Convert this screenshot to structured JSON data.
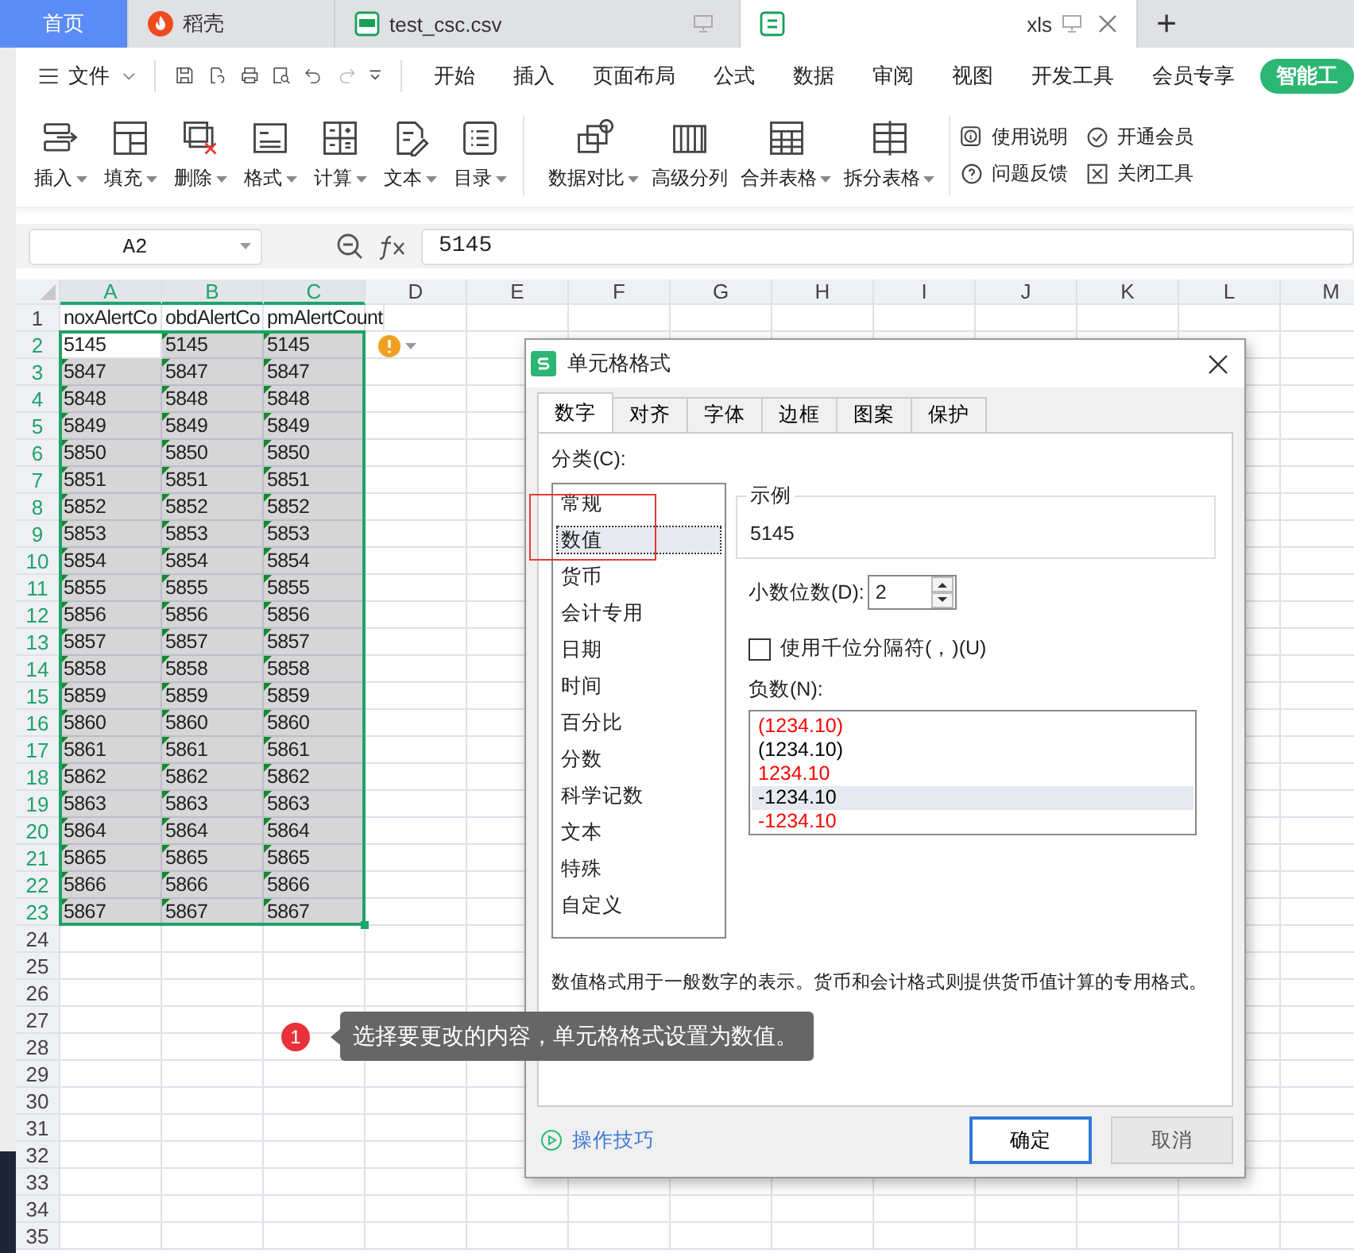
{
  "tabs": [
    {
      "label": "首页",
      "kind": "home",
      "selected": false
    },
    {
      "label": "稻壳",
      "kind": "docer",
      "selected": false
    },
    {
      "label": "test_csc.csv",
      "kind": "csv",
      "selected": false
    },
    {
      "label": "xls",
      "kind": "xls",
      "selected": true
    }
  ],
  "new_tab_button": "+",
  "menu": {
    "file": "文件",
    "items": [
      "开始",
      "插入",
      "页面布局",
      "公式",
      "数据",
      "审阅",
      "视图",
      "开发工具",
      "会员专享"
    ],
    "ai_button": "智能工"
  },
  "toolbar": {
    "groups": [
      [
        {
          "label": "插入",
          "kind": "insert"
        },
        {
          "label": "填充",
          "kind": "fill"
        },
        {
          "label": "删除",
          "kind": "delete"
        },
        {
          "label": "格式",
          "kind": "format"
        },
        {
          "label": "计算",
          "kind": "calc"
        },
        {
          "label": "文本",
          "kind": "text"
        },
        {
          "label": "目录",
          "kind": "toc"
        }
      ],
      [
        {
          "label": "数据对比",
          "kind": "compare"
        },
        {
          "label": "高级分列",
          "kind": "split"
        },
        {
          "label": "合并表格",
          "kind": "merge"
        },
        {
          "label": "拆分表格",
          "kind": "splittable"
        }
      ]
    ],
    "links": [
      {
        "label": "使用说明",
        "kind": "info"
      },
      {
        "label": "开通会员",
        "kind": "member"
      },
      {
        "label": "问题反馈",
        "kind": "help"
      },
      {
        "label": "关闭工具",
        "kind": "close"
      }
    ]
  },
  "formula_bar": {
    "cell": "A2",
    "value": "5145"
  },
  "sheet": {
    "columns": [
      {
        "label": "A",
        "selected": true
      },
      {
        "label": "B",
        "selected": true
      },
      {
        "label": "C",
        "selected": true
      },
      {
        "label": "D",
        "selected": false
      },
      {
        "label": "E",
        "selected": false
      },
      {
        "label": "F",
        "selected": false
      },
      {
        "label": "G",
        "selected": false
      },
      {
        "label": "H",
        "selected": false
      },
      {
        "label": "I",
        "selected": false
      },
      {
        "label": "J",
        "selected": false
      },
      {
        "label": "K",
        "selected": false
      },
      {
        "label": "L",
        "selected": false
      },
      {
        "label": "M",
        "selected": false
      }
    ],
    "rows": [
      {
        "number": "1",
        "selected": false,
        "cells": [
          {
            "text": "noxAlertCo",
            "selected": false,
            "flagged": false
          },
          {
            "text": "obdAlertCo",
            "selected": false,
            "flagged": false
          },
          {
            "text": "pmAlertCount",
            "selected": false,
            "flagged": false
          }
        ]
      },
      {
        "number": "2",
        "selected": true,
        "warning": true,
        "cells": [
          {
            "text": "5145",
            "selected": false,
            "flagged": false
          },
          {
            "text": "5145",
            "selected": true,
            "flagged": true
          },
          {
            "text": "5145",
            "selected": true,
            "flagged": true
          }
        ]
      },
      {
        "number": "3",
        "selected": true,
        "cells": [
          {
            "text": "5847",
            "selected": true,
            "flagged": true
          },
          {
            "text": "5847",
            "selected": true,
            "flagged": true
          },
          {
            "text": "5847",
            "selected": true,
            "flagged": true
          }
        ]
      },
      {
        "number": "4",
        "selected": true,
        "cells": [
          {
            "text": "5848",
            "selected": true,
            "flagged": true
          },
          {
            "text": "5848",
            "selected": true,
            "flagged": true
          },
          {
            "text": "5848",
            "selected": true,
            "flagged": true
          }
        ]
      },
      {
        "number": "5",
        "selected": true,
        "cells": [
          {
            "text": "5849",
            "selected": true,
            "flagged": true
          },
          {
            "text": "5849",
            "selected": true,
            "flagged": true
          },
          {
            "text": "5849",
            "selected": true,
            "flagged": true
          }
        ]
      },
      {
        "number": "6",
        "selected": true,
        "cells": [
          {
            "text": "5850",
            "selected": true,
            "flagged": true
          },
          {
            "text": "5850",
            "selected": true,
            "flagged": true
          },
          {
            "text": "5850",
            "selected": true,
            "flagged": true
          }
        ]
      },
      {
        "number": "7",
        "selected": true,
        "cells": [
          {
            "text": "5851",
            "selected": true,
            "flagged": true
          },
          {
            "text": "5851",
            "selected": true,
            "flagged": true
          },
          {
            "text": "5851",
            "selected": true,
            "flagged": true
          }
        ]
      },
      {
        "number": "8",
        "selected": true,
        "cells": [
          {
            "text": "5852",
            "selected": true,
            "flagged": true
          },
          {
            "text": "5852",
            "selected": true,
            "flagged": true
          },
          {
            "text": "5852",
            "selected": true,
            "flagged": true
          }
        ]
      },
      {
        "number": "9",
        "selected": true,
        "cells": [
          {
            "text": "5853",
            "selected": true,
            "flagged": true
          },
          {
            "text": "5853",
            "selected": true,
            "flagged": true
          },
          {
            "text": "5853",
            "selected": true,
            "flagged": true
          }
        ]
      },
      {
        "number": "10",
        "selected": true,
        "cells": [
          {
            "text": "5854",
            "selected": true,
            "flagged": true
          },
          {
            "text": "5854",
            "selected": true,
            "flagged": true
          },
          {
            "text": "5854",
            "selected": true,
            "flagged": true
          }
        ]
      },
      {
        "number": "11",
        "selected": true,
        "cells": [
          {
            "text": "5855",
            "selected": true,
            "flagged": true
          },
          {
            "text": "5855",
            "selected": true,
            "flagged": true
          },
          {
            "text": "5855",
            "selected": true,
            "flagged": true
          }
        ]
      },
      {
        "number": "12",
        "selected": true,
        "cells": [
          {
            "text": "5856",
            "selected": true,
            "flagged": true
          },
          {
            "text": "5856",
            "selected": true,
            "flagged": true
          },
          {
            "text": "5856",
            "selected": true,
            "flagged": true
          }
        ]
      },
      {
        "number": "13",
        "selected": true,
        "cells": [
          {
            "text": "5857",
            "selected": true,
            "flagged": true
          },
          {
            "text": "5857",
            "selected": true,
            "flagged": true
          },
          {
            "text": "5857",
            "selected": true,
            "flagged": true
          }
        ]
      },
      {
        "number": "14",
        "selected": true,
        "cells": [
          {
            "text": "5858",
            "selected": true,
            "flagged": true
          },
          {
            "text": "5858",
            "selected": true,
            "flagged": true
          },
          {
            "text": "5858",
            "selected": true,
            "flagged": true
          }
        ]
      },
      {
        "number": "15",
        "selected": true,
        "cells": [
          {
            "text": "5859",
            "selected": true,
            "flagged": true
          },
          {
            "text": "5859",
            "selected": true,
            "flagged": true
          },
          {
            "text": "5859",
            "selected": true,
            "flagged": true
          }
        ]
      },
      {
        "number": "16",
        "selected": true,
        "cells": [
          {
            "text": "5860",
            "selected": true,
            "flagged": true
          },
          {
            "text": "5860",
            "selected": true,
            "flagged": true
          },
          {
            "text": "5860",
            "selected": true,
            "flagged": true
          }
        ]
      },
      {
        "number": "17",
        "selected": true,
        "cells": [
          {
            "text": "5861",
            "selected": true,
            "flagged": true
          },
          {
            "text": "5861",
            "selected": true,
            "flagged": true
          },
          {
            "text": "5861",
            "selected": true,
            "flagged": true
          }
        ]
      },
      {
        "number": "18",
        "selected": true,
        "cells": [
          {
            "text": "5862",
            "selected": true,
            "flagged": true
          },
          {
            "text": "5862",
            "selected": true,
            "flagged": true
          },
          {
            "text": "5862",
            "selected": true,
            "flagged": true
          }
        ]
      },
      {
        "number": "19",
        "selected": true,
        "cells": [
          {
            "text": "5863",
            "selected": true,
            "flagged": true
          },
          {
            "text": "5863",
            "selected": true,
            "flagged": true
          },
          {
            "text": "5863",
            "selected": true,
            "flagged": true
          }
        ]
      },
      {
        "number": "20",
        "selected": true,
        "cells": [
          {
            "text": "5864",
            "selected": true,
            "flagged": true
          },
          {
            "text": "5864",
            "selected": true,
            "flagged": true
          },
          {
            "text": "5864",
            "selected": true,
            "flagged": true
          }
        ]
      },
      {
        "number": "21",
        "selected": true,
        "cells": [
          {
            "text": "5865",
            "selected": true,
            "flagged": true
          },
          {
            "text": "5865",
            "selected": true,
            "flagged": true
          },
          {
            "text": "5865",
            "selected": true,
            "flagged": true
          }
        ]
      },
      {
        "number": "22",
        "selected": true,
        "cells": [
          {
            "text": "5866",
            "selected": true,
            "flagged": true
          },
          {
            "text": "5866",
            "selected": true,
            "flagged": true
          },
          {
            "text": "5866",
            "selected": true,
            "flagged": true
          }
        ]
      },
      {
        "number": "23",
        "selected": true,
        "cells": [
          {
            "text": "5867",
            "selected": true,
            "flagged": true
          },
          {
            "text": "5867",
            "selected": true,
            "flagged": true
          },
          {
            "text": "5867",
            "selected": true,
            "flagged": true
          }
        ]
      },
      {
        "number": "24",
        "selected": false,
        "cells": []
      },
      {
        "number": "25",
        "selected": false,
        "cells": []
      },
      {
        "number": "26",
        "selected": false,
        "cells": []
      },
      {
        "number": "27",
        "selected": false,
        "cells": []
      },
      {
        "number": "28",
        "selected": false,
        "cells": []
      },
      {
        "number": "29",
        "selected": false,
        "cells": []
      },
      {
        "number": "30",
        "selected": false,
        "cells": []
      },
      {
        "number": "31",
        "selected": false,
        "cells": []
      },
      {
        "number": "32",
        "selected": false,
        "cells": []
      },
      {
        "number": "33",
        "selected": false,
        "cells": []
      },
      {
        "number": "34",
        "selected": false,
        "cells": []
      },
      {
        "number": "35",
        "selected": false,
        "cells": []
      }
    ]
  },
  "dialog": {
    "title": "单元格格式",
    "tabs": [
      {
        "label": "数字",
        "selected": true
      },
      {
        "label": "对齐",
        "selected": false
      },
      {
        "label": "字体",
        "selected": false
      },
      {
        "label": "边框",
        "selected": false
      },
      {
        "label": "图案",
        "selected": false
      },
      {
        "label": "保护",
        "selected": false
      }
    ],
    "category_label": "分类(C):",
    "categories": [
      {
        "label": "常规",
        "selected": false
      },
      {
        "label": "数值",
        "selected": true
      },
      {
        "label": "货币",
        "selected": false
      },
      {
        "label": "会计专用",
        "selected": false
      },
      {
        "label": "日期",
        "selected": false
      },
      {
        "label": "时间",
        "selected": false
      },
      {
        "label": "百分比",
        "selected": false
      },
      {
        "label": "分数",
        "selected": false
      },
      {
        "label": "科学记数",
        "selected": false
      },
      {
        "label": "文本",
        "selected": false
      },
      {
        "label": "特殊",
        "selected": false
      },
      {
        "label": "自定义",
        "selected": false
      }
    ],
    "sample": {
      "label": "示例",
      "value": "5145"
    },
    "decimals": {
      "label": "小数位数(D):",
      "value": "2"
    },
    "thousands": {
      "label": "使用千位分隔符(，)(U)",
      "checked": false
    },
    "negative": {
      "label": "负数(N):",
      "options": [
        {
          "text": "(1234.10)",
          "color": "#ff0000",
          "selected": false
        },
        {
          "text": "(1234.10)",
          "color": "#000000",
          "selected": false
        },
        {
          "text": "1234.10",
          "color": "#ff0000",
          "selected": false
        },
        {
          "text": "-1234.10",
          "color": "#000000",
          "selected": true
        },
        {
          "text": "-1234.10",
          "color": "#ff0000",
          "selected": false
        }
      ]
    },
    "description": "数值格式用于一般数字的表示。货币和会计格式则提供货币值计算的专用格式。",
    "tips_link": "操作技巧",
    "buttons": [
      {
        "label": "确定",
        "kind": "primary"
      },
      {
        "label": "取消",
        "kind": "secondary"
      }
    ]
  },
  "annotation": {
    "number": "1",
    "text": "选择要更改的内容，单元格格式设置为数值。"
  }
}
